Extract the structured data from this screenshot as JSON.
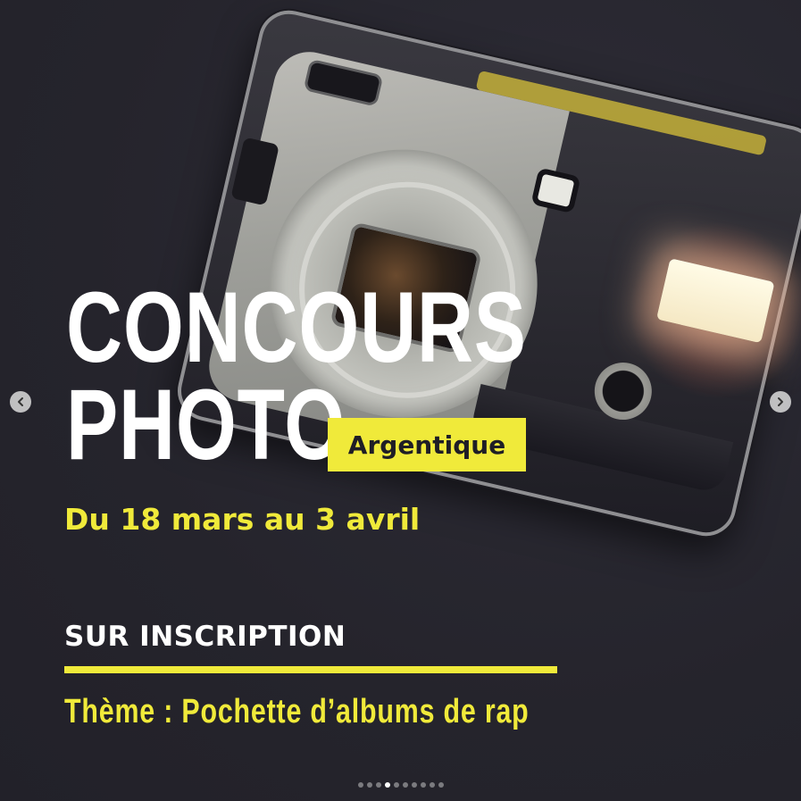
{
  "post": {
    "title_line1": "CONCOURS",
    "title_line2": "PHOTO",
    "tag": "Argentique",
    "dates": "Du 18 mars au 3 avril",
    "inscription": "SUR INSCRIPTION",
    "theme": "Thème : Pochette d’albums de rap",
    "image_subject": "film-camera-illustration"
  },
  "colors": {
    "background": "#26252e",
    "accent_yellow": "#f0ea3a",
    "text_white": "#ffffff"
  },
  "carousel": {
    "prev_icon": "chevron-left-icon",
    "next_icon": "chevron-right-icon",
    "total_slides": 10,
    "active_slide": 4
  }
}
